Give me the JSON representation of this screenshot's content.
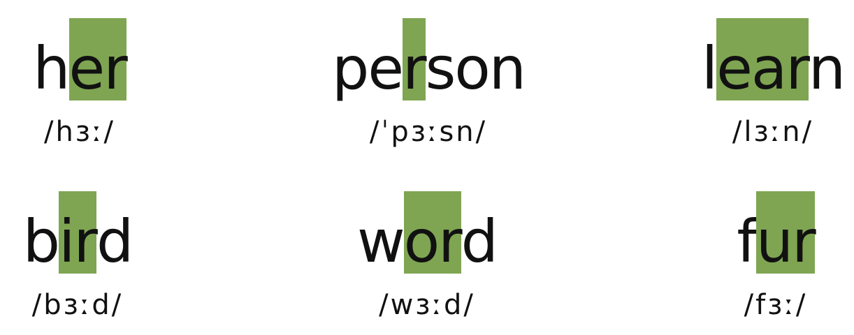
{
  "highlight_color": "#7fa552",
  "words": [
    {
      "pre": "h",
      "hl": "er",
      "post": "",
      "ipa": "/hɜː/"
    },
    {
      "pre": "pe",
      "hl": "r",
      "post": "son",
      "ipa": "/ˈpɜːsn/"
    },
    {
      "pre": "l",
      "hl": "ear",
      "post": "n",
      "ipa": "/lɜːn/"
    },
    {
      "pre": "b",
      "hl": "ir",
      "post": "d",
      "ipa": "/bɜːd/"
    },
    {
      "pre": "w",
      "hl": "or",
      "post": "d",
      "ipa": "/wɜːd/"
    },
    {
      "pre": "f",
      "hl": "ur",
      "post": "",
      "ipa": "/fɜː/"
    }
  ]
}
